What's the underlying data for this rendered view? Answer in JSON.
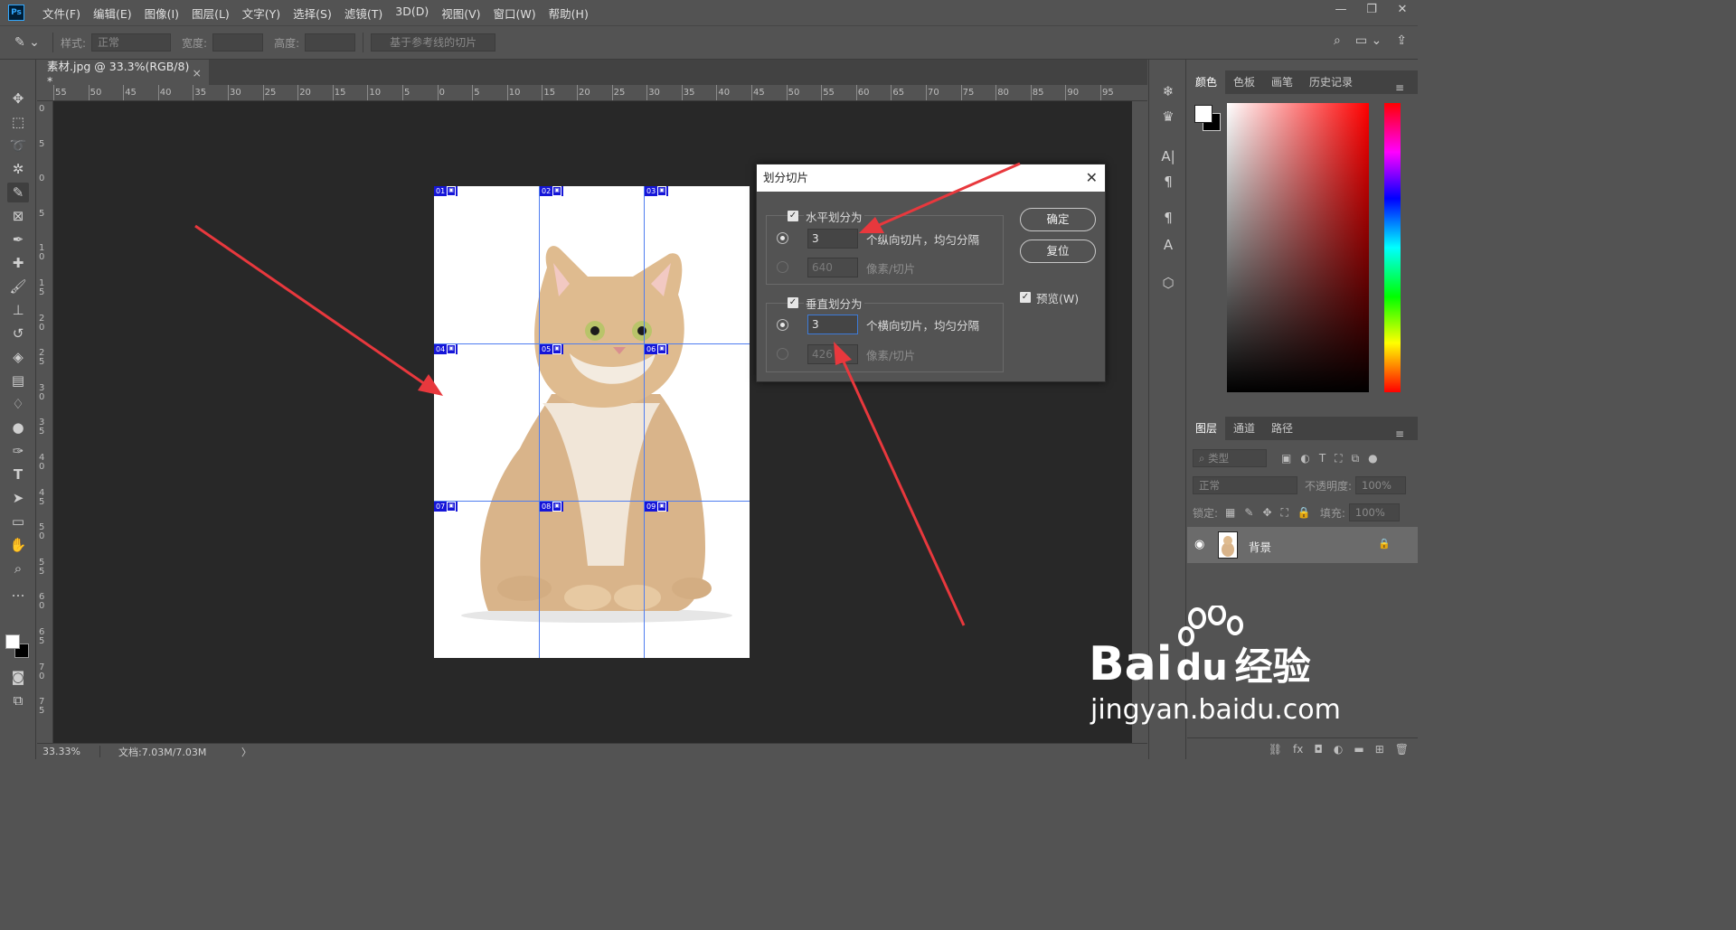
{
  "app": {
    "logo": "Ps"
  },
  "menu": [
    "文件(F)",
    "编辑(E)",
    "图像(I)",
    "图层(L)",
    "文字(Y)",
    "选择(S)",
    "滤镜(T)",
    "3D(D)",
    "视图(V)",
    "窗口(W)",
    "帮助(H)"
  ],
  "window_controls": [
    "—",
    "❐",
    "✕"
  ],
  "options": {
    "style_label": "样式:",
    "style_value": "正常",
    "width_label": "宽度:",
    "height_label": "高度:",
    "slices_from_guides": "基于参考线的切片"
  },
  "document": {
    "tab_title": "素材.jpg @ 33.3%(RGB/8) *",
    "tab_close": "×"
  },
  "ruler": {
    "h_ticks": [
      "55",
      "50",
      "45",
      "40",
      "35",
      "30",
      "25",
      "20",
      "15",
      "10",
      "5",
      "0",
      "5",
      "10",
      "15",
      "20",
      "25",
      "30",
      "35",
      "40",
      "45",
      "50",
      "55",
      "60",
      "65",
      "70",
      "75",
      "80",
      "85",
      "90",
      "95"
    ],
    "v_ticks": [
      "0",
      "5",
      "0",
      "5",
      "10",
      "15",
      "20",
      "25",
      "30",
      "35",
      "40",
      "45",
      "50",
      "55",
      "60",
      "65",
      "70",
      "75"
    ]
  },
  "slices": [
    "01",
    "02",
    "03",
    "04",
    "05",
    "06",
    "07",
    "08",
    "09"
  ],
  "dialog": {
    "title": "划分切片",
    "close": "✕",
    "horizontal": {
      "label": "水平划分为",
      "count_value": "3",
      "count_suffix": "个纵向切片，均匀分隔",
      "pixels_value": "640",
      "pixels_suffix": "像素/切片"
    },
    "vertical": {
      "label": "垂直划分为",
      "count_value": "3",
      "count_suffix": "个横向切片，均匀分隔",
      "pixels_value": "426",
      "pixels_suffix": "像素/切片"
    },
    "ok": "确定",
    "reset": "复位",
    "preview_label": "预览(W)"
  },
  "status": {
    "zoom": "33.33%",
    "doc": "文档:7.03M/7.03M",
    "arrow": "〉"
  },
  "color_panel": {
    "tabs": [
      "颜色",
      "色板",
      "画笔",
      "历史记录"
    ],
    "menu": "≡"
  },
  "layers_panel": {
    "tabs": [
      "图层",
      "通道",
      "路径"
    ],
    "filter_placeholder": "类型",
    "blend_mode": "正常",
    "opacity_label": "不透明度:",
    "opacity_value": "100%",
    "lock_label": "锁定:",
    "fill_label": "填充:",
    "fill_value": "100%",
    "layer_name": "背景"
  },
  "watermark": {
    "brand": "Bai",
    "brand2": "du",
    "cn": "经验",
    "url": "jingyan.baidu.com"
  },
  "colors": {
    "slice_line": "#4f7df0",
    "slice_label": "#1515d8",
    "arrow": "#e8383d",
    "accent": "#31a8ff"
  }
}
